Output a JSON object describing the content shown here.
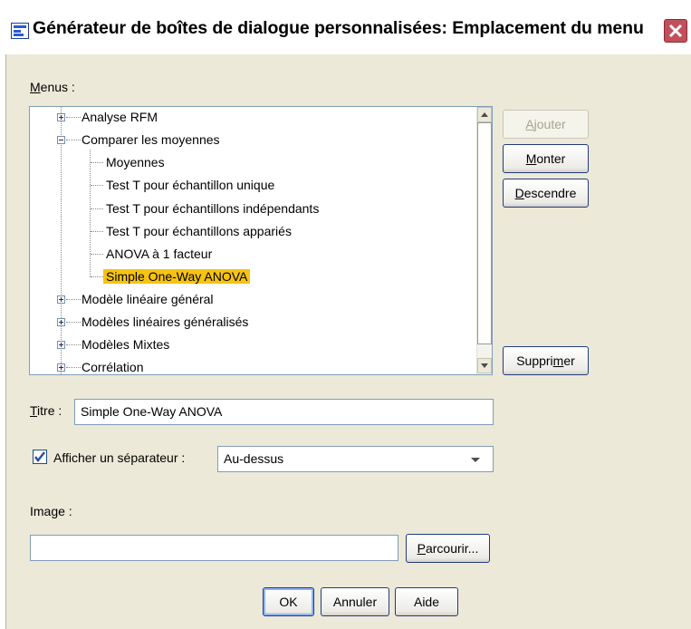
{
  "window": {
    "title": "Générateur de boîtes de dialogue personnalisées: Emplacement du menu"
  },
  "menus_label": {
    "u": "M",
    "rest": "enus :"
  },
  "tree": [
    {
      "label": "Analyse RFM",
      "expander": "plus"
    },
    {
      "label": "Comparer les moyennes",
      "expander": "minus"
    },
    {
      "label": "Moyennes"
    },
    {
      "label": "Test T pour échantillon unique"
    },
    {
      "label": "Test T pour échantillons indépendants"
    },
    {
      "label": "Test T pour échantillons appariés"
    },
    {
      "label": "ANOVA à 1 facteur"
    },
    {
      "label": "Simple One-Way ANOVA",
      "selected": true
    },
    {
      "label": "Modèle linéaire général",
      "expander": "plus"
    },
    {
      "label": "Modèles linéaires généralisés",
      "expander": "plus"
    },
    {
      "label": "Modèles Mixtes",
      "expander": "plus"
    },
    {
      "label": "Corrélation",
      "expander": "plus"
    }
  ],
  "buttons": {
    "add": {
      "u": "A",
      "rest": "jouter",
      "disabled": true
    },
    "up": {
      "u": "M",
      "rest": "onter"
    },
    "down": {
      "u": "D",
      "rest": "escendre"
    },
    "delete": {
      "pre": "Suppri",
      "u": "m",
      "rest": "er"
    },
    "browse": {
      "u": "P",
      "rest": "arcourir..."
    },
    "ok": "OK",
    "cancel": "Annuler",
    "help": "Aide"
  },
  "title_field": {
    "label_u": "T",
    "label_rest": "itre :",
    "value": "Simple One-Way ANOVA"
  },
  "separator": {
    "checked": true,
    "label": "Afficher un séparateur :",
    "value": "Au-dessus"
  },
  "image_field": {
    "label": "Image :",
    "value": ""
  },
  "colors": {
    "selection": "#f7c312",
    "accent": "#1f3c81",
    "close": "#c0505b"
  }
}
